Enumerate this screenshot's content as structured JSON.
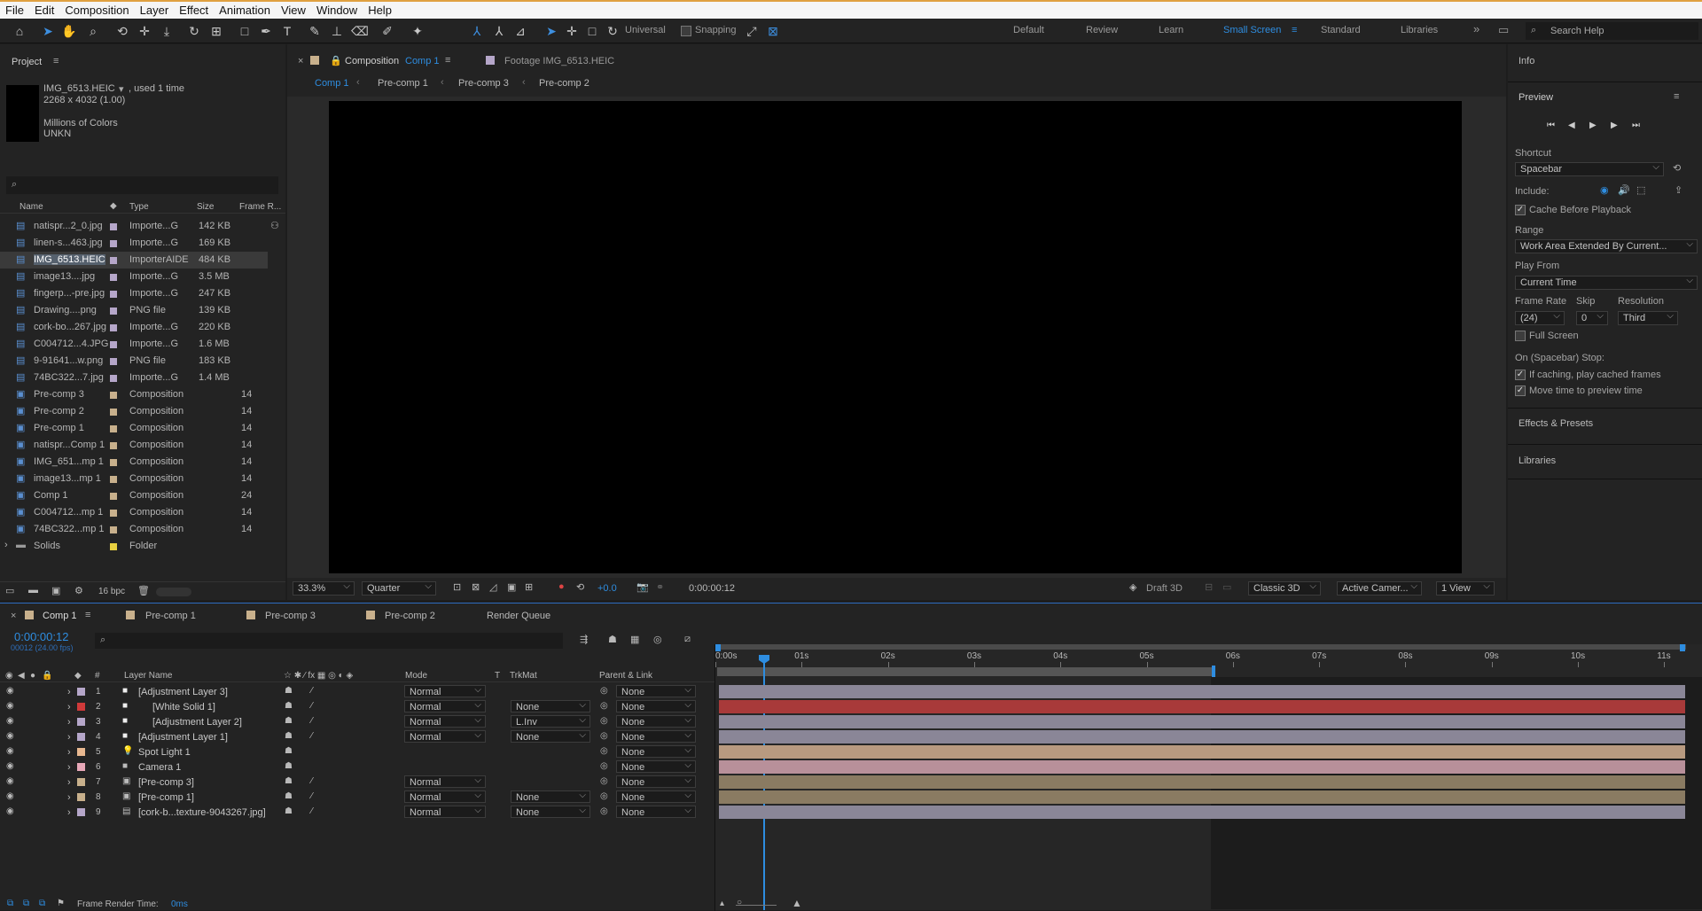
{
  "menu": [
    "File",
    "Edit",
    "Composition",
    "Layer",
    "Effect",
    "Animation",
    "View",
    "Window",
    "Help"
  ],
  "toolbar": {
    "universal": "Universal",
    "snapping": "Snapping"
  },
  "workspaces": [
    "Default",
    "Review",
    "Learn",
    "Small Screen",
    "Standard",
    "Libraries"
  ],
  "search_placeholder": "Search Help",
  "project": {
    "title": "Project",
    "file_name": "IMG_6513.HEIC",
    "used": ", used 1 time",
    "dims": "2268 x 4032 (1.00)",
    "colors": "Millions of Colors",
    "unkn": "UNKN",
    "cols": [
      "Name",
      "Type",
      "Size",
      "Frame R..."
    ],
    "items": [
      {
        "name": "natispr...2_0.jpg",
        "type": "Importe...G",
        "size": "142 KB",
        "rate": "",
        "color": "#b5a6c9",
        "kind": "file"
      },
      {
        "name": "linen-s...463.jpg",
        "type": "Importe...G",
        "size": "169 KB",
        "rate": "",
        "color": "#b5a6c9",
        "kind": "file"
      },
      {
        "name": "IMG_6513.HEIC",
        "type": "ImporterAIDE",
        "size": "484 KB",
        "rate": "",
        "color": "#b5a6c9",
        "kind": "file",
        "selected": true
      },
      {
        "name": "image13....jpg",
        "type": "Importe...G",
        "size": "3.5 MB",
        "rate": "",
        "color": "#b5a6c9",
        "kind": "file"
      },
      {
        "name": "fingerp...-pre.jpg",
        "type": "Importe...G",
        "size": "247 KB",
        "rate": "",
        "color": "#b5a6c9",
        "kind": "file"
      },
      {
        "name": "Drawing....png",
        "type": "PNG file",
        "size": "139 KB",
        "rate": "",
        "color": "#b5a6c9",
        "kind": "file"
      },
      {
        "name": "cork-bo...267.jpg",
        "type": "Importe...G",
        "size": "220 KB",
        "rate": "",
        "color": "#b5a6c9",
        "kind": "file"
      },
      {
        "name": "C004712...4.JPG",
        "type": "Importe...G",
        "size": "1.6 MB",
        "rate": "",
        "color": "#b5a6c9",
        "kind": "file"
      },
      {
        "name": "9-91641...w.png",
        "type": "PNG file",
        "size": "183 KB",
        "rate": "",
        "color": "#b5a6c9",
        "kind": "file"
      },
      {
        "name": "74BC322...7.jpg",
        "type": "Importe...G",
        "size": "1.4 MB",
        "rate": "",
        "color": "#b5a6c9",
        "kind": "file"
      },
      {
        "name": "Pre-comp 3",
        "type": "Composition",
        "size": "",
        "rate": "14",
        "color": "#c8b08c",
        "kind": "comp"
      },
      {
        "name": "Pre-comp 2",
        "type": "Composition",
        "size": "",
        "rate": "14",
        "color": "#c8b08c",
        "kind": "comp"
      },
      {
        "name": "Pre-comp 1",
        "type": "Composition",
        "size": "",
        "rate": "14",
        "color": "#c8b08c",
        "kind": "comp"
      },
      {
        "name": "natispr...Comp 1",
        "type": "Composition",
        "size": "",
        "rate": "14",
        "color": "#c8b08c",
        "kind": "comp"
      },
      {
        "name": "IMG_651...mp 1",
        "type": "Composition",
        "size": "",
        "rate": "14",
        "color": "#c8b08c",
        "kind": "comp"
      },
      {
        "name": "image13...mp 1",
        "type": "Composition",
        "size": "",
        "rate": "14",
        "color": "#c8b08c",
        "kind": "comp"
      },
      {
        "name": "Comp 1",
        "type": "Composition",
        "size": "",
        "rate": "24",
        "color": "#c8b08c",
        "kind": "comp"
      },
      {
        "name": "C004712...mp 1",
        "type": "Composition",
        "size": "",
        "rate": "14",
        "color": "#c8b08c",
        "kind": "comp"
      },
      {
        "name": "74BC322...mp 1",
        "type": "Composition",
        "size": "",
        "rate": "14",
        "color": "#c8b08c",
        "kind": "comp"
      },
      {
        "name": "Solids",
        "type": "Folder",
        "size": "",
        "rate": "",
        "color": "#e8d040",
        "kind": "folder"
      }
    ],
    "bpc": "16 bpc"
  },
  "viewer": {
    "tab1_prefix": "Composition",
    "tab1_name": "Comp 1",
    "tab2": "Footage  IMG_6513.HEIC",
    "crumbs": [
      "Comp 1",
      "Pre-comp 1",
      "Pre-comp 3",
      "Pre-comp 2"
    ],
    "zoom": "33.3%",
    "quality": "Quarter",
    "exposure": "+0.0",
    "timecode": "0:00:00:12",
    "draft3d": "Draft 3D",
    "renderer": "Classic 3D",
    "camera": "Active Camer...",
    "views": "1 View"
  },
  "right": {
    "info": "Info",
    "preview": "Preview",
    "shortcut_label": "Shortcut",
    "shortcut": "Spacebar",
    "include": "Include:",
    "cache": "Cache Before Playback",
    "range_label": "Range",
    "range": "Work Area Extended By Current...",
    "playfrom_label": "Play From",
    "playfrom": "Current Time",
    "fr_label": "Frame Rate",
    "skip_label": "Skip",
    "res_label": "Resolution",
    "fr": "(24)",
    "skip": "0",
    "res": "Third",
    "fullscreen": "Full Screen",
    "onstop": "On (Spacebar) Stop:",
    "ifcaching": "If caching, play cached frames",
    "movetime": "Move time to preview time",
    "effects": "Effects & Presets",
    "libraries": "Libraries"
  },
  "timeline": {
    "tabs": [
      "Comp 1",
      "Pre-comp 1",
      "Pre-comp 3",
      "Pre-comp 2",
      "Render Queue"
    ],
    "timecode": "0:00:00:12",
    "frames": "00012 (24.00 fps)",
    "cols": {
      "layer_name": "Layer Name",
      "mode": "Mode",
      "t": "T",
      "trkmat": "TrkMat",
      "parent": "Parent & Link"
    },
    "ruler": [
      "0:00s",
      "01s",
      "02s",
      "03s",
      "04s",
      "05s",
      "06s",
      "07s",
      "08s",
      "09s",
      "10s",
      "11s"
    ],
    "layers": [
      {
        "num": "1",
        "name": "[Adjustment Layer 3]",
        "color": "#b5a6c9",
        "mode": "Normal",
        "trkmat": "",
        "parent": "None",
        "bar": "#8a8697",
        "icon": "solid"
      },
      {
        "num": "2",
        "name": "[White Solid 1]",
        "color": "#d03a3a",
        "mode": "Normal",
        "trkmat": "None",
        "parent": "None",
        "bar": "#a83a3a",
        "icon": "solid"
      },
      {
        "num": "3",
        "name": "[Adjustment Layer 2]",
        "color": "#b5a6c9",
        "mode": "Normal",
        "trkmat": "L.Inv",
        "parent": "None",
        "bar": "#8a8697",
        "icon": "solid"
      },
      {
        "num": "4",
        "name": "[Adjustment Layer 1]",
        "color": "#b5a6c9",
        "mode": "Normal",
        "trkmat": "None",
        "parent": "None",
        "bar": "#8a8697",
        "icon": "solid"
      },
      {
        "num": "5",
        "name": "Spot Light 1",
        "color": "#e8b890",
        "mode": "",
        "trkmat": "",
        "parent": "None",
        "bar": "#b89a80",
        "icon": "light"
      },
      {
        "num": "6",
        "name": "Camera 1",
        "color": "#e8a8b8",
        "mode": "",
        "trkmat": "",
        "parent": "None",
        "bar": "#b8909a",
        "icon": "camera"
      },
      {
        "num": "7",
        "name": "[Pre-comp 3]",
        "color": "#c8b08c",
        "mode": "Normal",
        "trkmat": "",
        "parent": "None",
        "bar": "#8a7b62",
        "icon": "comp"
      },
      {
        "num": "8",
        "name": "[Pre-comp 1]",
        "color": "#c8b08c",
        "mode": "Normal",
        "trkmat": "None",
        "parent": "None",
        "bar": "#8a7b62",
        "icon": "comp"
      },
      {
        "num": "9",
        "name": "[cork-b...texture-9043267.jpg]",
        "color": "#b5a6c9",
        "mode": "Normal",
        "trkmat": "None",
        "parent": "None",
        "bar": "#8a8697",
        "icon": "file"
      }
    ],
    "render_time_label": "Frame Render Time:",
    "render_time": "0ms"
  }
}
